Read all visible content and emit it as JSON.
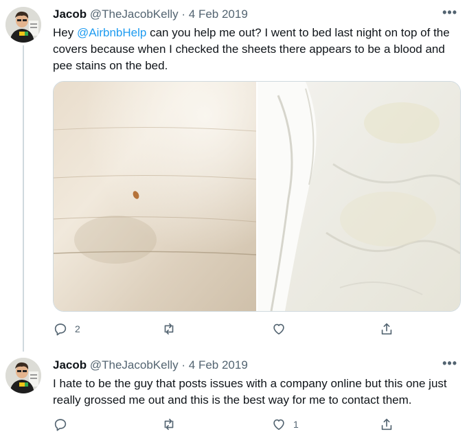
{
  "tweets": [
    {
      "author": {
        "name": "Jacob",
        "handle": "@TheJacobKelly",
        "separator": "·",
        "date": "4 Feb 2019"
      },
      "more_icon": "more-horizontal-icon",
      "text": {
        "before": "Hey ",
        "mention": "@AirbnbHelp",
        "after": " can you help me out? I went to bed last night on top of the covers because when I checked the sheets there appears to be a blood and pee stains on the bed."
      },
      "media_count": 2,
      "actions": {
        "replies": "2",
        "retweets": "",
        "likes": "",
        "share_icon": "share-icon"
      }
    },
    {
      "author": {
        "name": "Jacob",
        "handle": "@TheJacobKelly",
        "separator": "·",
        "date": "4 Feb 2019"
      },
      "more_icon": "more-horizontal-icon",
      "text": {
        "before": "I hate to be the guy that posts issues with a company online but this one just really grossed me out and this is the best way for me to contact them.",
        "mention": "",
        "after": ""
      },
      "actions": {
        "replies": "",
        "retweets": "",
        "likes": "1",
        "share_icon": "share-icon"
      }
    }
  ],
  "colors": {
    "accent": "#1d9bf0",
    "secondary_text": "#536471",
    "border": "#cfd9de"
  }
}
